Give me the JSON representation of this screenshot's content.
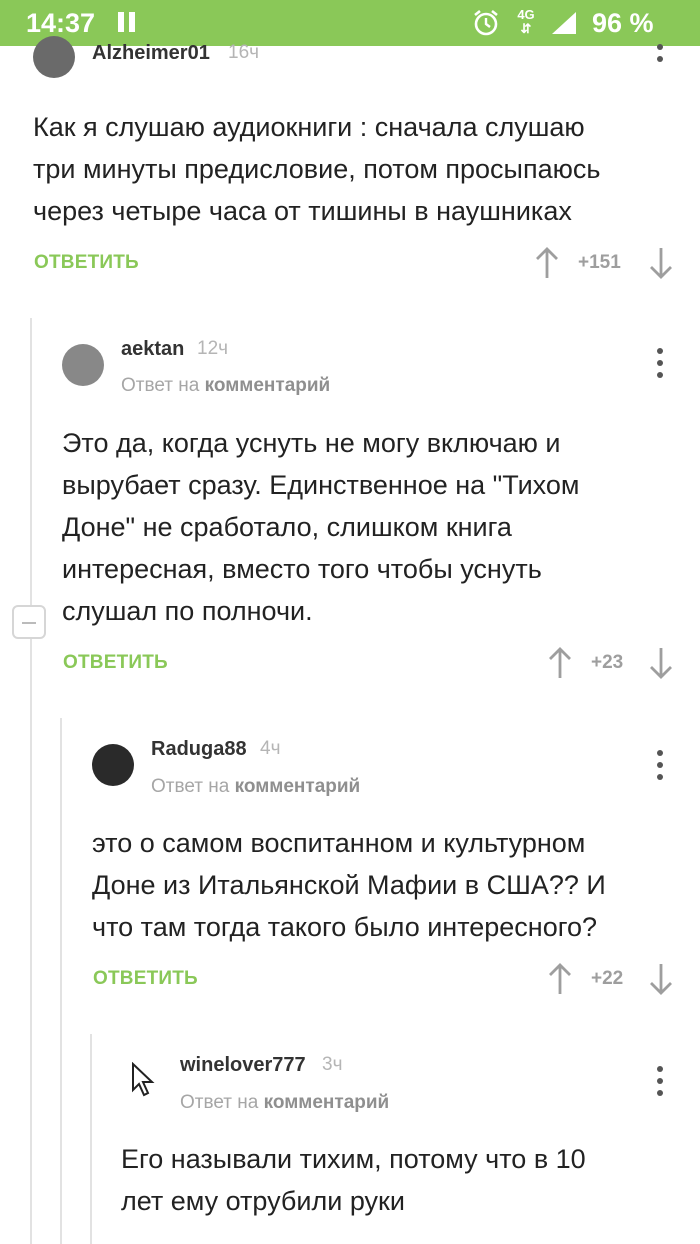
{
  "status_bar": {
    "time": "14:37",
    "network": "4G",
    "battery": "96 %"
  },
  "ui": {
    "reply_label": "ОТВЕТИТЬ",
    "reply_to_prefix": "Ответ на",
    "reply_to_target": "комментарий"
  },
  "comments": [
    {
      "author": "Alzheimer01",
      "time": "16ч",
      "text": [
        "Как я слушаю аудиокниги : сначала слушаю",
        "три минуты предисловие, потом просыпаюсь",
        "через четыре часа от тишины в наушниках"
      ],
      "score": "+151"
    },
    {
      "author": "aektan",
      "time": "12ч",
      "text": [
        "Это да, когда уснуть не могу включаю и",
        "вырубает сразу. Единственное на \"Тихом",
        "Доне\" не сработало, слишком книга",
        "интересная, вместо того чтобы уснуть",
        "слушал по полночи."
      ],
      "score": "+23"
    },
    {
      "author": "Raduga88",
      "time": "4ч",
      "text": [
        "это о самом воспитанном и культурном",
        "Доне из Итальянской Мафии в США?? И",
        "что там тогда такого было интересного?"
      ],
      "score": "+22"
    },
    {
      "author": "winelover777",
      "time": "3ч",
      "text": [
        "Его называли тихим, потому что в 10",
        "лет ему отрубили руки"
      ]
    }
  ]
}
